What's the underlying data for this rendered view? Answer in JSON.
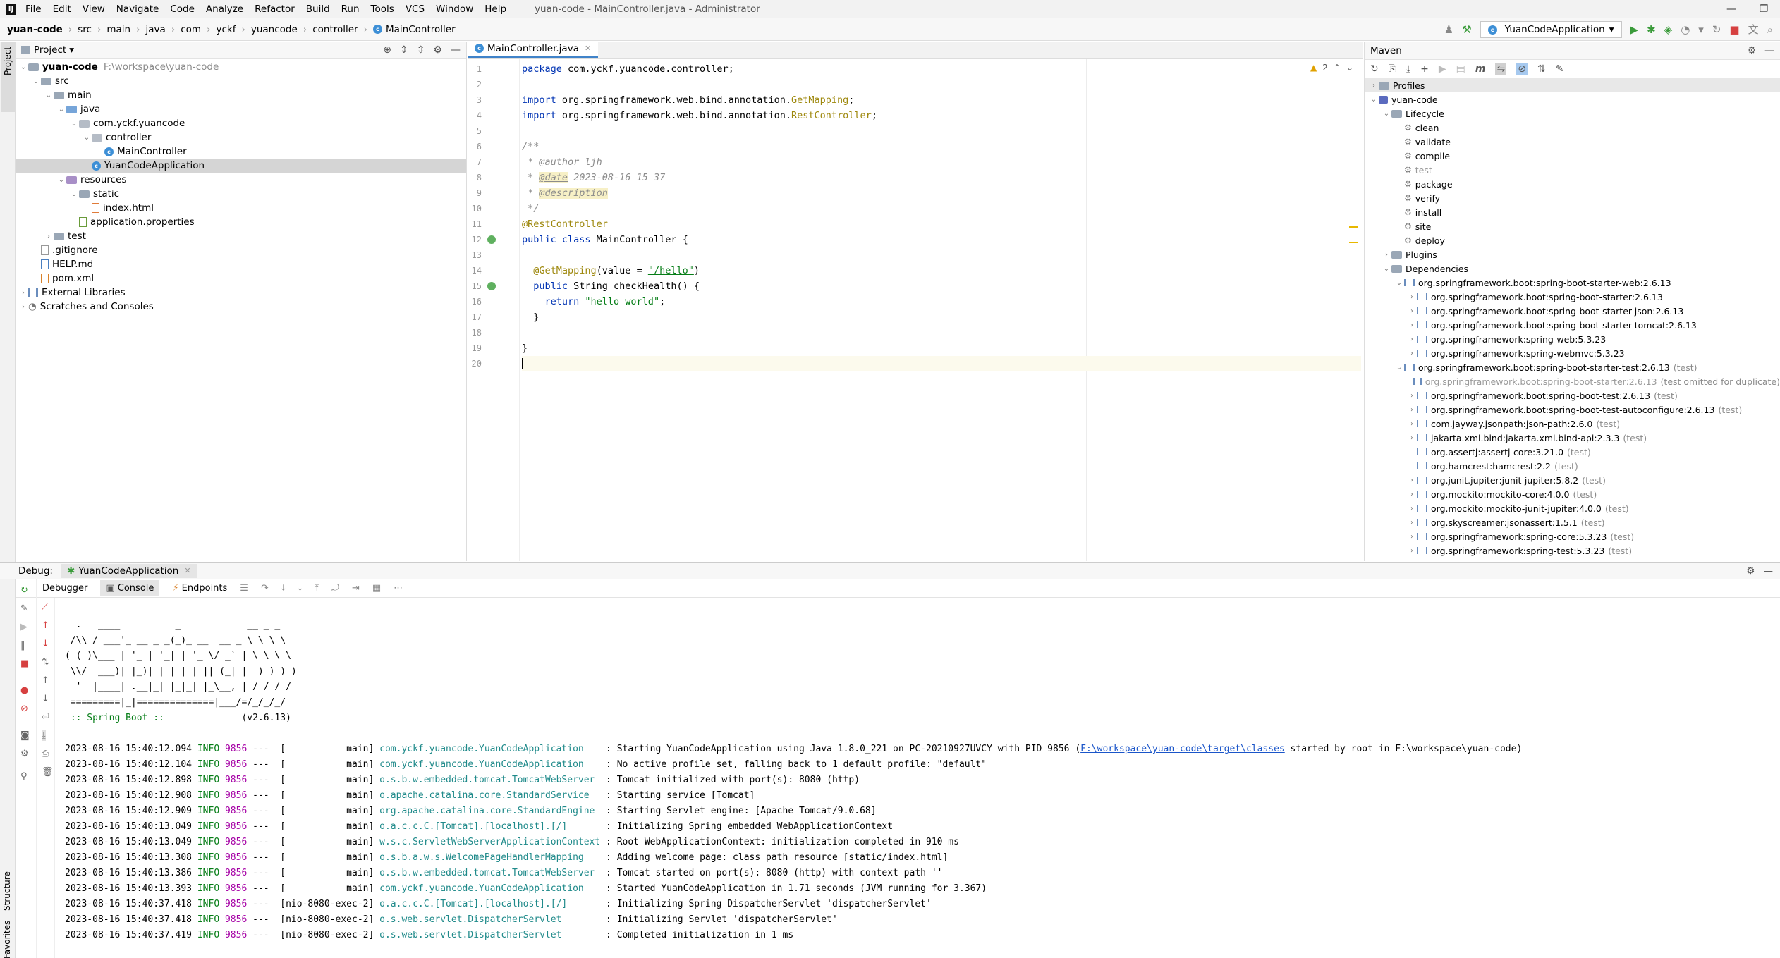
{
  "menubar": {
    "items": [
      "File",
      "Edit",
      "View",
      "Navigate",
      "Code",
      "Analyze",
      "Refactor",
      "Build",
      "Run",
      "Tools",
      "VCS",
      "Window",
      "Help"
    ],
    "window_title": "yuan-code - MainController.java - Administrator"
  },
  "navbar": {
    "crumbs": [
      "yuan-code",
      "src",
      "main",
      "java",
      "com",
      "yckf",
      "yuancode",
      "controller",
      "MainController"
    ],
    "run_config": "YuanCodeApplication"
  },
  "side_labels": {
    "project": "Project",
    "structure": "Structure",
    "favorites": "Favorites"
  },
  "project": {
    "title": "Project",
    "tree": [
      {
        "label": "yuan-code",
        "path": "F:\\workspace\\yuan-code",
        "kind": "module",
        "depth": 0,
        "expanded": true
      },
      {
        "label": "src",
        "kind": "folder",
        "depth": 1,
        "expanded": true
      },
      {
        "label": "main",
        "kind": "folder",
        "depth": 2,
        "expanded": true
      },
      {
        "label": "java",
        "kind": "src",
        "depth": 3,
        "expanded": true
      },
      {
        "label": "com.yckf.yuancode",
        "kind": "pkg",
        "depth": 4,
        "expanded": true
      },
      {
        "label": "controller",
        "kind": "pkg",
        "depth": 5,
        "expanded": true
      },
      {
        "label": "MainController",
        "kind": "class",
        "depth": 6
      },
      {
        "label": "YuanCodeApplication",
        "kind": "class",
        "depth": 5,
        "selected": true
      },
      {
        "label": "resources",
        "kind": "res",
        "depth": 3,
        "expanded": true
      },
      {
        "label": "static",
        "kind": "folder",
        "depth": 4,
        "expanded": true
      },
      {
        "label": "index.html",
        "kind": "html",
        "depth": 5
      },
      {
        "label": "application.properties",
        "kind": "props",
        "depth": 4
      },
      {
        "label": "test",
        "kind": "folder",
        "depth": 2,
        "expanded": false
      },
      {
        "label": ".gitignore",
        "kind": "file",
        "depth": 1
      },
      {
        "label": "HELP.md",
        "kind": "md",
        "depth": 1
      },
      {
        "label": "pom.xml",
        "kind": "xml",
        "depth": 1
      },
      {
        "label": "External Libraries",
        "kind": "libs",
        "depth": 0,
        "expanded": false
      },
      {
        "label": "Scratches and Consoles",
        "kind": "scratch",
        "depth": 0,
        "expanded": false
      }
    ]
  },
  "editor": {
    "tab": "MainController.java",
    "warnings": "2",
    "lines": [
      [
        {
          "t": "package ",
          "c": "kw"
        },
        {
          "t": "com.yckf.yuancode.controller;",
          "c": ""
        }
      ],
      [],
      [
        {
          "t": "import ",
          "c": "kw"
        },
        {
          "t": "org.springframework.web.bind.annotation.",
          "c": ""
        },
        {
          "t": "GetMapping",
          "c": "ann"
        },
        {
          "t": ";",
          "c": ""
        }
      ],
      [
        {
          "t": "import ",
          "c": "kw"
        },
        {
          "t": "org.springframework.web.bind.annotation.",
          "c": ""
        },
        {
          "t": "RestController",
          "c": "ann"
        },
        {
          "t": ";",
          "c": ""
        }
      ],
      [],
      [
        {
          "t": "/**",
          "c": "cmt"
        }
      ],
      [
        {
          "t": " * ",
          "c": "cmt"
        },
        {
          "t": "@author",
          "c": "tag"
        },
        {
          "t": " ljh",
          "c": "cmt"
        }
      ],
      [
        {
          "t": " * ",
          "c": "cmt"
        },
        {
          "t": "@date",
          "c": "tagh"
        },
        {
          "t": " 2023-08-16 15 37",
          "c": "cmt"
        }
      ],
      [
        {
          "t": " * ",
          "c": "cmt"
        },
        {
          "t": "@description",
          "c": "tagh"
        }
      ],
      [
        {
          "t": " */",
          "c": "cmt"
        }
      ],
      [
        {
          "t": "@RestController",
          "c": "ann"
        }
      ],
      [
        {
          "t": "public class ",
          "c": "kw"
        },
        {
          "t": "MainController {",
          "c": ""
        }
      ],
      [],
      [
        {
          "t": "  @GetMapping",
          "c": "ann"
        },
        {
          "t": "(value = ",
          "c": ""
        },
        {
          "t": "\"/hello\"",
          "c": "strl"
        },
        {
          "t": ")",
          "c": ""
        }
      ],
      [
        {
          "t": "  public ",
          "c": "kw"
        },
        {
          "t": "String checkHealth() {",
          "c": ""
        }
      ],
      [
        {
          "t": "    return ",
          "c": "kw"
        },
        {
          "t": "\"hello world\"",
          "c": "str"
        },
        {
          "t": ";",
          "c": ""
        }
      ],
      [
        {
          "t": "  }",
          "c": ""
        }
      ],
      [],
      [
        {
          "t": "}",
          "c": ""
        }
      ],
      []
    ]
  },
  "maven": {
    "title": "Maven",
    "tree": [
      {
        "label": "Profiles",
        "kind": "folder",
        "depth": 0,
        "arrow": "right",
        "selected": true
      },
      {
        "label": "yuan-code",
        "kind": "mvn",
        "depth": 0,
        "arrow": "down"
      },
      {
        "label": "Lifecycle",
        "kind": "folder",
        "depth": 1,
        "arrow": "down"
      },
      {
        "label": "clean",
        "kind": "gear",
        "depth": 2
      },
      {
        "label": "validate",
        "kind": "gear",
        "depth": 2
      },
      {
        "label": "compile",
        "kind": "gear",
        "depth": 2
      },
      {
        "label": "test",
        "kind": "gear",
        "depth": 2,
        "dim": true
      },
      {
        "label": "package",
        "kind": "gear",
        "depth": 2
      },
      {
        "label": "verify",
        "kind": "gear",
        "depth": 2
      },
      {
        "label": "install",
        "kind": "gear",
        "depth": 2
      },
      {
        "label": "site",
        "kind": "gear",
        "depth": 2
      },
      {
        "label": "deploy",
        "kind": "gear",
        "depth": 2
      },
      {
        "label": "Plugins",
        "kind": "folder",
        "depth": 1,
        "arrow": "right"
      },
      {
        "label": "Dependencies",
        "kind": "folder",
        "depth": 1,
        "arrow": "down"
      },
      {
        "label": "org.springframework.boot:spring-boot-starter-web:2.6.13",
        "kind": "dep",
        "depth": 2,
        "arrow": "down"
      },
      {
        "label": "org.springframework.boot:spring-boot-starter:2.6.13",
        "kind": "dep",
        "depth": 3,
        "arrow": "right"
      },
      {
        "label": "org.springframework.boot:spring-boot-starter-json:2.6.13",
        "kind": "dep",
        "depth": 3,
        "arrow": "right"
      },
      {
        "label": "org.springframework.boot:spring-boot-starter-tomcat:2.6.13",
        "kind": "dep",
        "depth": 3,
        "arrow": "right"
      },
      {
        "label": "org.springframework:spring-web:5.3.23",
        "kind": "dep",
        "depth": 3,
        "arrow": "right"
      },
      {
        "label": "org.springframework:spring-webmvc:5.3.23",
        "kind": "dep",
        "depth": 3,
        "arrow": "right"
      },
      {
        "label": "org.springframework.boot:spring-boot-starter-test:2.6.13",
        "scope": "(test)",
        "kind": "dep",
        "depth": 2,
        "arrow": "down"
      },
      {
        "label": "org.springframework.boot:spring-boot-starter:2.6.13",
        "scope": "(test omitted for duplicate)",
        "kind": "dep",
        "depth": 3,
        "dim": true
      },
      {
        "label": "org.springframework.boot:spring-boot-test:2.6.13",
        "scope": "(test)",
        "kind": "dep",
        "depth": 3,
        "arrow": "right"
      },
      {
        "label": "org.springframework.boot:spring-boot-test-autoconfigure:2.6.13",
        "scope": "(test)",
        "kind": "dep",
        "depth": 3,
        "arrow": "right"
      },
      {
        "label": "com.jayway.jsonpath:json-path:2.6.0",
        "scope": "(test)",
        "kind": "dep",
        "depth": 3,
        "arrow": "right"
      },
      {
        "label": "jakarta.xml.bind:jakarta.xml.bind-api:2.3.3",
        "scope": "(test)",
        "kind": "dep",
        "depth": 3,
        "arrow": "right"
      },
      {
        "label": "org.assertj:assertj-core:3.21.0",
        "scope": "(test)",
        "kind": "dep",
        "depth": 3
      },
      {
        "label": "org.hamcrest:hamcrest:2.2",
        "scope": "(test)",
        "kind": "dep",
        "depth": 3
      },
      {
        "label": "org.junit.jupiter:junit-jupiter:5.8.2",
        "scope": "(test)",
        "kind": "dep",
        "depth": 3,
        "arrow": "right"
      },
      {
        "label": "org.mockito:mockito-core:4.0.0",
        "scope": "(test)",
        "kind": "dep",
        "depth": 3,
        "arrow": "right"
      },
      {
        "label": "org.mockito:mockito-junit-jupiter:4.0.0",
        "scope": "(test)",
        "kind": "dep",
        "depth": 3,
        "arrow": "right"
      },
      {
        "label": "org.skyscreamer:jsonassert:1.5.1",
        "scope": "(test)",
        "kind": "dep",
        "depth": 3,
        "arrow": "right"
      },
      {
        "label": "org.springframework:spring-core:5.3.23",
        "scope": "(test)",
        "kind": "dep",
        "depth": 3,
        "arrow": "right"
      },
      {
        "label": "org.springframework:spring-test:5.3.23",
        "scope": "(test)",
        "kind": "dep",
        "depth": 3,
        "arrow": "right"
      }
    ]
  },
  "debug": {
    "label": "Debug:",
    "session_tab": "YuanCodeApplication",
    "tabs": [
      "Debugger",
      "Console",
      "Endpoints"
    ],
    "banner": [
      "  .   ____          _            __ _ _",
      " /\\\\ / ___'_ __ _ _(_)_ __  __ _ \\ \\ \\ \\",
      "( ( )\\___ | '_ | '_| | '_ \\/ _` | \\ \\ \\ \\",
      " \\\\/  ___)| |_)| | | | | || (_| |  ) ) ) )",
      "  '  |____| .__|_| |_|_| |_\\__, | / / / /",
      " =========|_|==============|___/=/_/_/_/"
    ],
    "boot_line": " :: Spring Boot ::",
    "boot_version": "(v2.6.13)",
    "log": [
      {
        "ts": "2023-08-16 15:40:12.094",
        "lvl": "INFO",
        "pid": "9856",
        "thread": "---  [           main]",
        "cls": "com.yckf.yuancode.YuanCodeApplication    ",
        "msg": ": Starting YuanCodeApplication using Java 1.8.0_221 on PC-20210927UVCY with PID 9856 (",
        "link": "F:\\workspace\\yuan-code\\target\\classes",
        "tail": " started by root in F:\\workspace\\yuan-code)"
      },
      {
        "ts": "2023-08-16 15:40:12.104",
        "lvl": "INFO",
        "pid": "9856",
        "thread": "---  [           main]",
        "cls": "com.yckf.yuancode.YuanCodeApplication    ",
        "msg": ": No active profile set, falling back to 1 default profile: \"default\""
      },
      {
        "ts": "2023-08-16 15:40:12.898",
        "lvl": "INFO",
        "pid": "9856",
        "thread": "---  [           main]",
        "cls": "o.s.b.w.embedded.tomcat.TomcatWebServer  ",
        "msg": ": Tomcat initialized with port(s): 8080 (http)"
      },
      {
        "ts": "2023-08-16 15:40:12.908",
        "lvl": "INFO",
        "pid": "9856",
        "thread": "---  [           main]",
        "cls": "o.apache.catalina.core.StandardService   ",
        "msg": ": Starting service [Tomcat]"
      },
      {
        "ts": "2023-08-16 15:40:12.909",
        "lvl": "INFO",
        "pid": "9856",
        "thread": "---  [           main]",
        "cls": "org.apache.catalina.core.StandardEngine  ",
        "msg": ": Starting Servlet engine: [Apache Tomcat/9.0.68]"
      },
      {
        "ts": "2023-08-16 15:40:13.049",
        "lvl": "INFO",
        "pid": "9856",
        "thread": "---  [           main]",
        "cls": "o.a.c.c.C.[Tomcat].[localhost].[/]       ",
        "msg": ": Initializing Spring embedded WebApplicationContext"
      },
      {
        "ts": "2023-08-16 15:40:13.049",
        "lvl": "INFO",
        "pid": "9856",
        "thread": "---  [           main]",
        "cls": "w.s.c.ServletWebServerApplicationContext ",
        "msg": ": Root WebApplicationContext: initialization completed in 910 ms"
      },
      {
        "ts": "2023-08-16 15:40:13.308",
        "lvl": "INFO",
        "pid": "9856",
        "thread": "---  [           main]",
        "cls": "o.s.b.a.w.s.WelcomePageHandlerMapping    ",
        "msg": ": Adding welcome page: class path resource [static/index.html]"
      },
      {
        "ts": "2023-08-16 15:40:13.386",
        "lvl": "INFO",
        "pid": "9856",
        "thread": "---  [           main]",
        "cls": "o.s.b.w.embedded.tomcat.TomcatWebServer  ",
        "msg": ": Tomcat started on port(s): 8080 (http) with context path ''"
      },
      {
        "ts": "2023-08-16 15:40:13.393",
        "lvl": "INFO",
        "pid": "9856",
        "thread": "---  [           main]",
        "cls": "com.yckf.yuancode.YuanCodeApplication    ",
        "msg": ": Started YuanCodeApplication in 1.71 seconds (JVM running for 3.367)"
      },
      {
        "ts": "2023-08-16 15:40:37.418",
        "lvl": "INFO",
        "pid": "9856",
        "thread": "---  [nio-8080-exec-2]",
        "cls": "o.a.c.c.C.[Tomcat].[localhost].[/]       ",
        "msg": ": Initializing Spring DispatcherServlet 'dispatcherServlet'"
      },
      {
        "ts": "2023-08-16 15:40:37.418",
        "lvl": "INFO",
        "pid": "9856",
        "thread": "---  [nio-8080-exec-2]",
        "cls": "o.s.web.servlet.DispatcherServlet        ",
        "msg": ": Initializing Servlet 'dispatcherServlet'"
      },
      {
        "ts": "2023-08-16 15:40:37.419",
        "lvl": "INFO",
        "pid": "9856",
        "thread": "---  [nio-8080-exec-2]",
        "cls": "o.s.web.servlet.DispatcherServlet        ",
        "msg": ": Completed initialization in 1 ms"
      }
    ]
  }
}
